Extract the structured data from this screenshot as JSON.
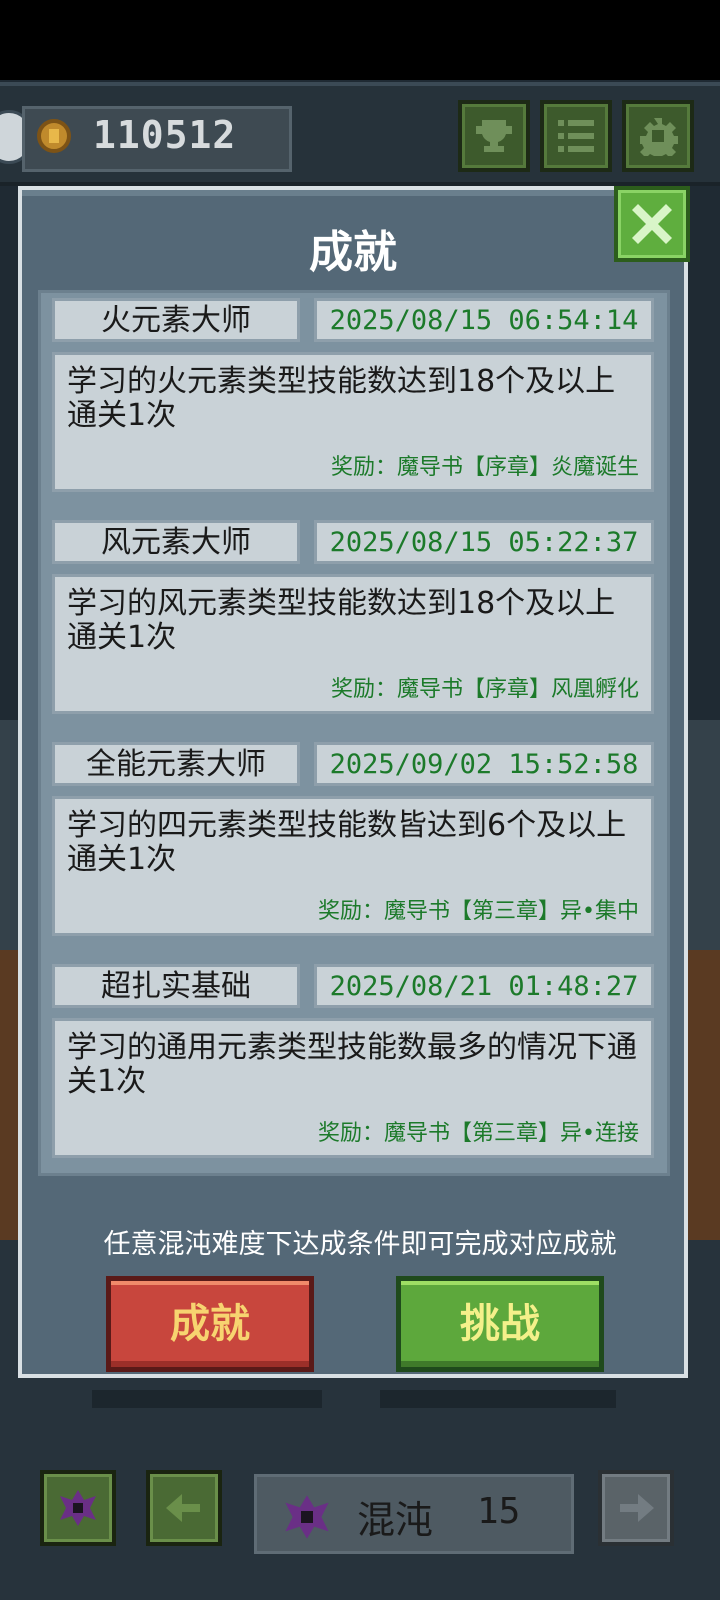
{
  "header": {
    "coins": "110512"
  },
  "modal": {
    "title": "成就",
    "achievements": [
      {
        "name": "火元素大师",
        "time": "2025/08/15 06:54:14",
        "description": "学习的火元素类型技能数达到18个及以上通关1次",
        "reward": "奖励：魔导书【序章】炎魔诞生"
      },
      {
        "name": "风元素大师",
        "time": "2025/08/15 05:22:37",
        "description": "学习的风元素类型技能数达到18个及以上通关1次",
        "reward": "奖励：魔导书【序章】风凰孵化"
      },
      {
        "name": "全能元素大师",
        "time": "2025/09/02 15:52:58",
        "description": "学习的四元素类型技能数皆达到6个及以上通关1次",
        "reward": "奖励：魔导书【第三章】异•集中"
      },
      {
        "name": "超扎实基础",
        "time": "2025/08/21 01:48:27",
        "description": "学习的通用元素类型技能数最多的情况下通关1次",
        "reward": "奖励：魔导书【第三章】异•连接"
      }
    ],
    "hint": "任意混沌难度下达成条件即可完成对应成就",
    "achievements_button": "成就",
    "challenge_button": "挑战"
  },
  "footer": {
    "difficulty_label": "混沌",
    "difficulty_level": "15"
  },
  "colors": {
    "panel": "#546877",
    "card": "#c9d2d7",
    "reward_green": "#1c7a2a",
    "red_button": "#c8463d",
    "green_button": "#5da83c"
  },
  "icons": [
    "trophy-icon",
    "list-icon",
    "gear-icon",
    "close-icon",
    "chaos-icon",
    "arrow-left-icon",
    "arrow-right-icon",
    "coin-icon"
  ]
}
